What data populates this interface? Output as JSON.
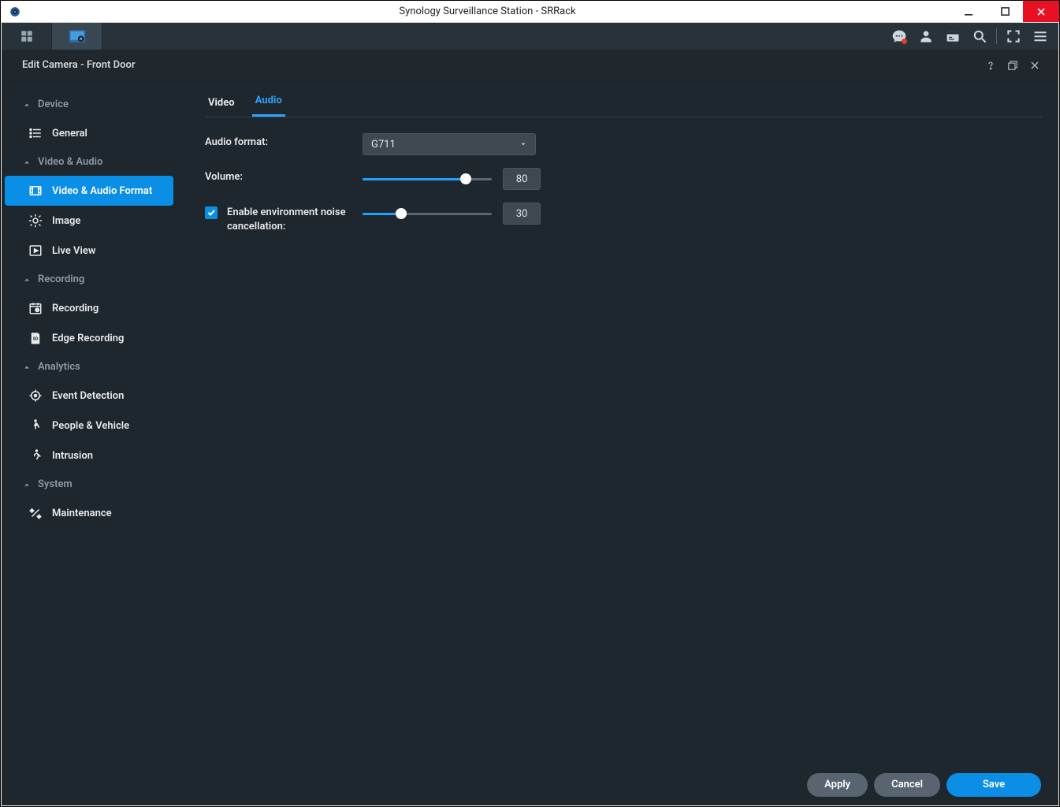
{
  "window": {
    "title": "Synology Surveillance Station - SRRack"
  },
  "panel": {
    "title": "Edit Camera - Front Door"
  },
  "sidebar": {
    "groups": [
      {
        "label": "Device",
        "items": [
          {
            "label": "General"
          }
        ]
      },
      {
        "label": "Video & Audio",
        "items": [
          {
            "label": "Video & Audio Format"
          },
          {
            "label": "Image"
          },
          {
            "label": "Live View"
          }
        ]
      },
      {
        "label": "Recording",
        "items": [
          {
            "label": "Recording"
          },
          {
            "label": "Edge Recording"
          }
        ]
      },
      {
        "label": "Analytics",
        "items": [
          {
            "label": "Event Detection"
          },
          {
            "label": "People & Vehicle"
          },
          {
            "label": "Intrusion"
          }
        ]
      },
      {
        "label": "System",
        "items": [
          {
            "label": "Maintenance"
          }
        ]
      }
    ]
  },
  "tabs": {
    "video": "Video",
    "audio": "Audio"
  },
  "form": {
    "audio_format_label": "Audio format:",
    "audio_format_value": "G711",
    "volume_label": "Volume:",
    "volume_value": "80",
    "volume_percent": 80,
    "noise_cancel_label": "Enable environment noise cancellation:",
    "noise_cancel_value": "30",
    "noise_cancel_percent": 30
  },
  "footer": {
    "apply": "Apply",
    "cancel": "Cancel",
    "save": "Save"
  }
}
